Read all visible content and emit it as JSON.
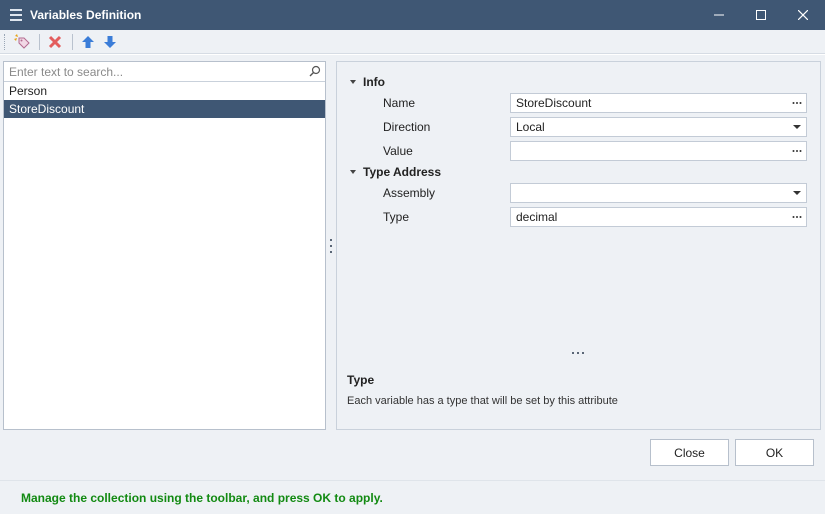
{
  "window": {
    "title": "Variables Definition",
    "icon": "list-icon"
  },
  "toolbar": {
    "buttons": [
      {
        "name": "add-item-button",
        "icon": "tag-add-icon"
      },
      {
        "name": "delete-item-button",
        "icon": "red-x-icon"
      },
      {
        "name": "move-up-button",
        "icon": "arrow-up-icon"
      },
      {
        "name": "move-down-button",
        "icon": "arrow-down-icon"
      }
    ]
  },
  "search": {
    "placeholder": "Enter text to search...",
    "value": ""
  },
  "list": {
    "items": [
      {
        "label": "Person",
        "selected": false
      },
      {
        "label": "StoreDiscount",
        "selected": true
      }
    ]
  },
  "properties": {
    "categories": [
      {
        "label": "Info",
        "expanded": true,
        "props": [
          {
            "label": "Name",
            "value": "StoreDiscount",
            "editor": "ellipsis"
          },
          {
            "label": "Direction",
            "value": "Local",
            "editor": "dropdown"
          },
          {
            "label": "Value",
            "value": "",
            "editor": "ellipsis"
          }
        ]
      },
      {
        "label": "Type Address",
        "expanded": true,
        "props": [
          {
            "label": "Assembly",
            "value": "",
            "editor": "dropdown"
          },
          {
            "label": "Type",
            "value": "decimal",
            "editor": "ellipsis"
          }
        ]
      }
    ],
    "description": {
      "title": "Type",
      "text": "Each variable has a type that will be set by this attribute"
    }
  },
  "footer": {
    "close_label": "Close",
    "ok_label": "OK",
    "status": "Manage the collection using the toolbar, and press OK to apply."
  },
  "colors": {
    "titlebar": "#3f5774",
    "selection": "#3f5774",
    "status_text": "#128a12",
    "panel_bg": "#eef1f5"
  }
}
